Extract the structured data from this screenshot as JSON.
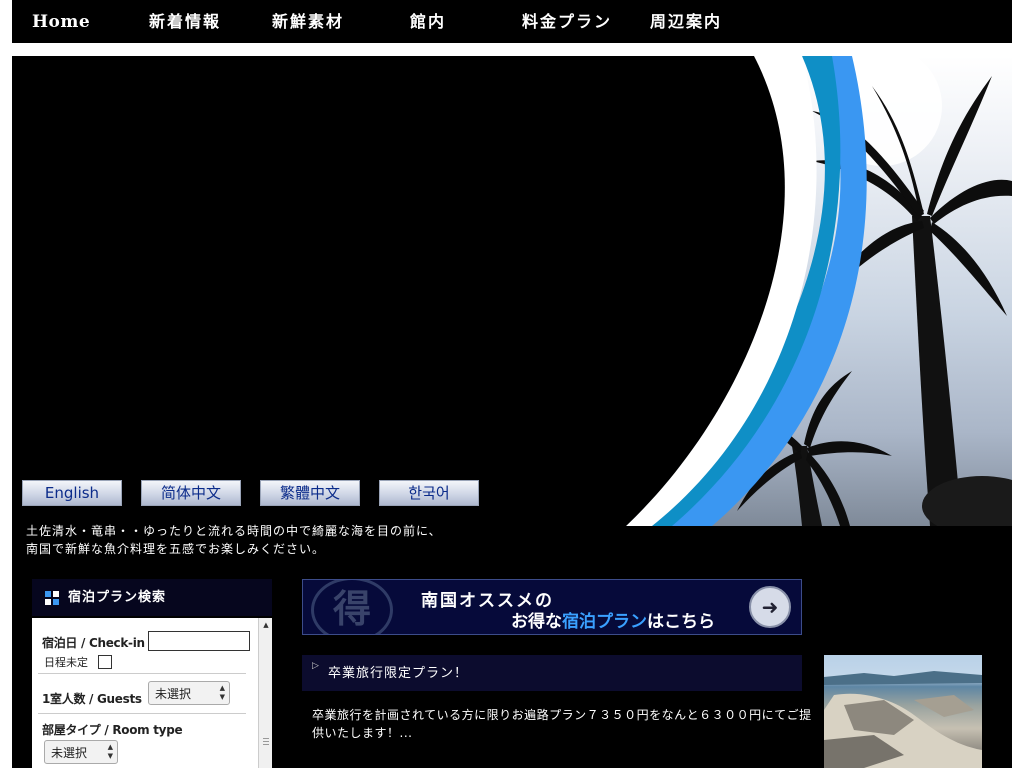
{
  "nav": {
    "items": [
      {
        "label": "Home"
      },
      {
        "label": "新着情報"
      },
      {
        "label": "新鮮素材"
      },
      {
        "label": "館内"
      },
      {
        "label": "料金プラン"
      },
      {
        "label": "周辺案内"
      }
    ]
  },
  "languages": [
    {
      "label": "English"
    },
    {
      "label": "简体中文"
    },
    {
      "label": "繁體中文"
    },
    {
      "label": "한국어"
    }
  ],
  "intro": {
    "line1": "土佐清水・竜串・・ゆったりと流れる時間の中で綺麗な海を目の前に、",
    "line2": "南国で新鮮な魚介料理を五感でお楽しみください。"
  },
  "search": {
    "title": "宿泊プラン検索",
    "checkin_label": "宿泊日 / Check-in",
    "checkin_value": "",
    "undecided_label": "日程未定",
    "guests_label": "1室人数 / Guests",
    "guests_value": "未選択",
    "roomtype_label": "部屋タイプ / Room type",
    "roomtype_value": "未選択"
  },
  "banner": {
    "kanji": "得",
    "line1": "南国オススメの",
    "line2_pre": "お得な",
    "line2_hl": "宿泊プラン",
    "line2_post": "はこちら"
  },
  "plan": {
    "title": "卒業旅行限定プラン！",
    "desc_line1": "卒業旅行を計画されている方に限りお遍路プラン７３５０円をなんと６３００円にてご提",
    "desc_line2": "供いたします！..."
  },
  "colors": {
    "accent_blue": "#3a97f2",
    "teal": "#0f8fc6",
    "nav_bg": "#000000"
  }
}
